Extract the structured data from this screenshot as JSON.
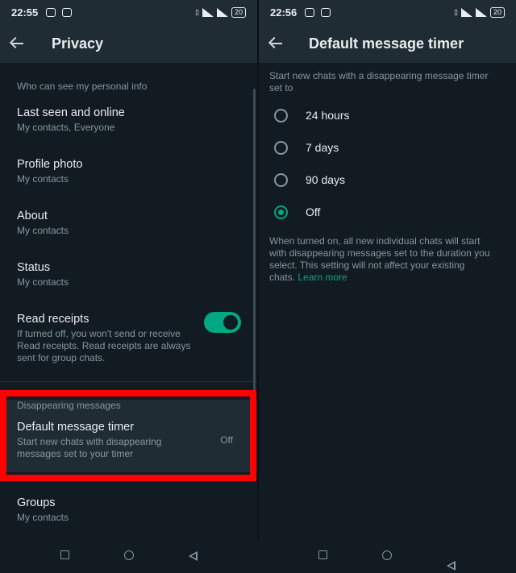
{
  "left": {
    "status": {
      "time": "22:55",
      "battery": "20"
    },
    "header": {
      "title": "Privacy"
    },
    "section1": "Who can see my personal info",
    "items": [
      {
        "title": "Last seen and online",
        "subtitle": "My contacts, Everyone"
      },
      {
        "title": "Profile photo",
        "subtitle": "My contacts"
      },
      {
        "title": "About",
        "subtitle": "My contacts"
      },
      {
        "title": "Status",
        "subtitle": "My contacts"
      }
    ],
    "read_receipts": {
      "title": "Read receipts",
      "subtitle": "If turned off, you won't send or receive Read receipts. Read receipts are always sent for group chats.",
      "enabled": true
    },
    "section2": "Disappearing messages",
    "timer": {
      "title": "Default message timer",
      "subtitle": "Start new chats with disappearing messages set to your timer",
      "value": "Off"
    },
    "groups": {
      "title": "Groups",
      "subtitle": "My contacts"
    }
  },
  "right": {
    "status": {
      "time": "22:56",
      "battery": "20"
    },
    "header": {
      "title": "Default message timer"
    },
    "intro": "Start new chats with a disappearing message timer set to",
    "options": [
      {
        "label": "24 hours",
        "selected": false
      },
      {
        "label": "7 days",
        "selected": false
      },
      {
        "label": "90 days",
        "selected": false
      },
      {
        "label": "Off",
        "selected": true
      }
    ],
    "description": "When turned on, all new individual chats will start with disappearing messages set to the duration you select. This setting will not affect your existing chats.",
    "learn_more": "Learn more"
  },
  "colors": {
    "accent": "#00a884",
    "highlight": "#ff0000",
    "background": "#111b21"
  }
}
